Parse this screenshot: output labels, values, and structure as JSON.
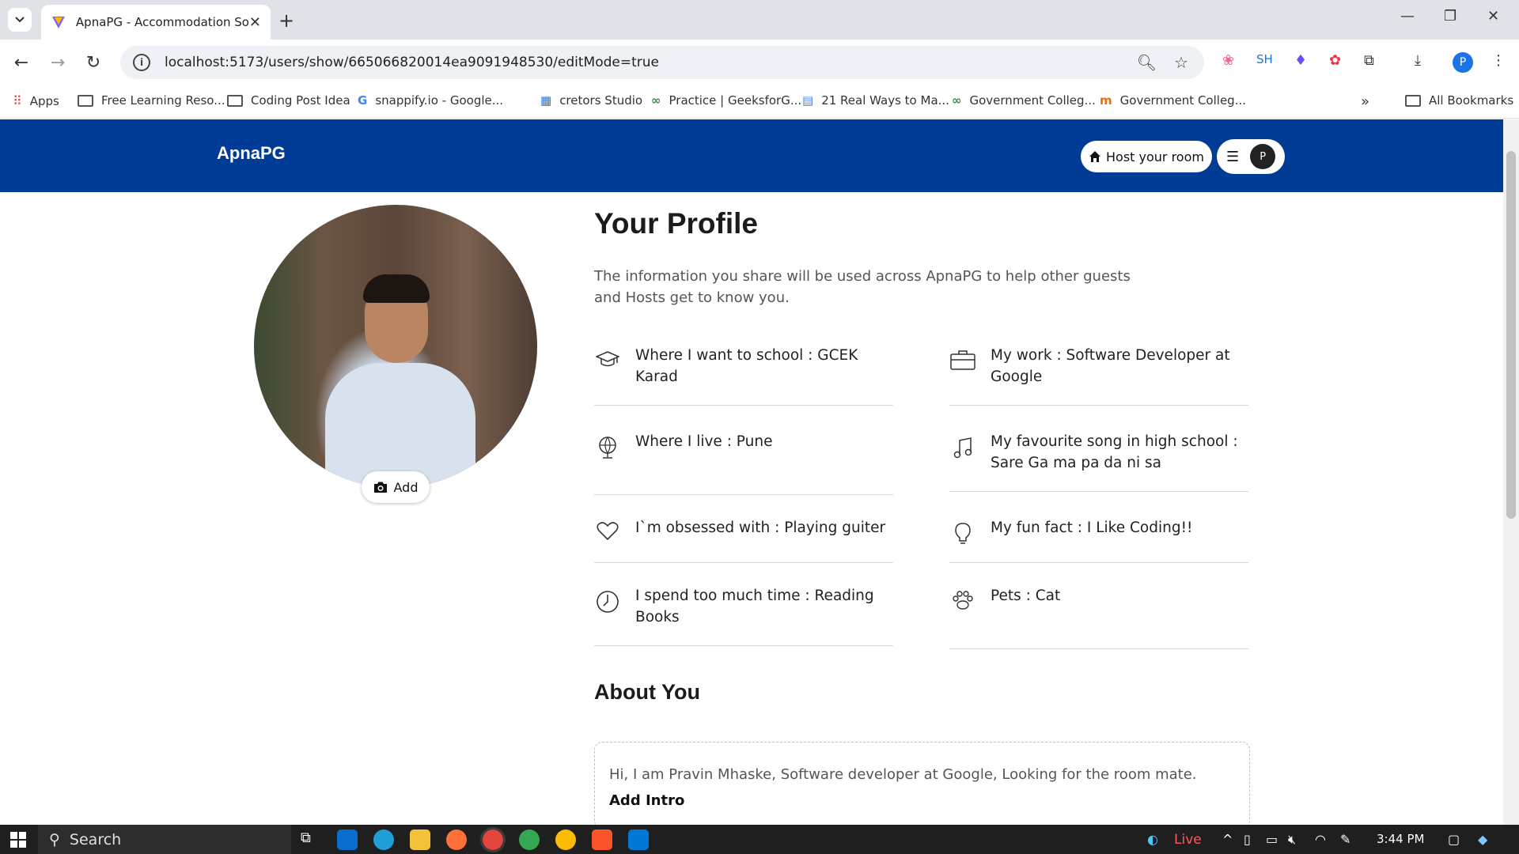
{
  "browser": {
    "tab_title": "ApnaPG - Accommodation Solu",
    "url": "localhost:5173/users/show/665066820014ea9091948530/editMode=true",
    "extension_sh": "SH",
    "profile_initial": "P",
    "bookmarks": [
      "Apps",
      "Free Learning Reso...",
      "Coding Post Idea",
      "snappify.io - Google...",
      "cretors Studio",
      "Practice | GeeksforG...",
      "21 Real Ways to Ma...",
      "Government Colleg...",
      "Government Colleg..."
    ],
    "all_bookmarks": "All Bookmarks"
  },
  "header": {
    "brand": "ApnaPG",
    "host_button": "Host your room",
    "avatar_initial": "P"
  },
  "profile": {
    "add_photo_label": "Add",
    "title": "Your Profile",
    "description": "The information you share will be used across ApnaPG to help other guests and Hosts get to know you.",
    "fields": [
      {
        "icon": "graduation-cap-icon",
        "text": "Where I want to school : GCEK Karad"
      },
      {
        "icon": "briefcase-icon",
        "text": "My work : Software Developer at Google"
      },
      {
        "icon": "globe-icon",
        "text": "Where I live : Pune"
      },
      {
        "icon": "music-note-icon",
        "text": "My favourite song in high school : Sare Ga ma pa da ni sa"
      },
      {
        "icon": "heart-icon",
        "text": "I`m obsessed with : Playing guiter"
      },
      {
        "icon": "lightbulb-icon",
        "text": "My fun fact : I Like Coding!!"
      },
      {
        "icon": "clock-icon",
        "text": "I spend too much time : Reading Books"
      },
      {
        "icon": "paw-icon",
        "text": "Pets : Cat"
      }
    ],
    "about_title": "About You",
    "intro_text": "Hi, I am Pravin Mhaske, Software developer at Google, Looking for the room mate.",
    "add_intro": "Add Intro"
  },
  "taskbar": {
    "search_label": "Search",
    "live_label": "Live",
    "time": "3:44 PM"
  },
  "colors": {
    "header_bg": "#003b95",
    "page_bg": "#ffffff",
    "taskbar_bg": "#1f1f1f"
  }
}
